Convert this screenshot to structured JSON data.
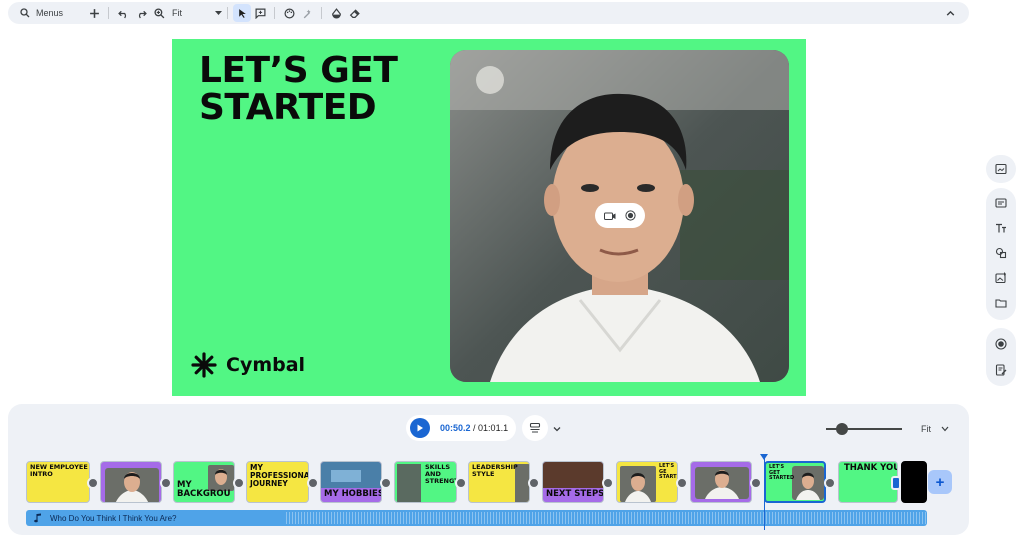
{
  "toolbar": {
    "menus_label": "Menus",
    "zoom_value": "Fit"
  },
  "slide": {
    "title_line1": "LET’S GET",
    "title_line2": "STARTED",
    "brand": "Cymbal",
    "bg_color": "#52f684"
  },
  "player": {
    "current_time": "00:50.2",
    "separator": " / ",
    "total_time": "01:01.1",
    "zoom_fit": "Fit"
  },
  "clips": [
    {
      "label": "NEW EMPLOYEE INTRO",
      "color": "#f5e642"
    },
    {
      "label": "",
      "color": "#a56be8"
    },
    {
      "label": "MY BACKGROU",
      "color": "#52f684"
    },
    {
      "label": "MY PROFESSIONAL JOURNEY",
      "color": "#f5e642"
    },
    {
      "label": "MY HOBBIES",
      "color": "#a56be8"
    },
    {
      "label": "SKILLS AND STRENGTI",
      "color": "#52f684"
    },
    {
      "label": "LEADERSHIP STYLE",
      "color": "#f5e642"
    },
    {
      "label": "NEXT STEPS",
      "color": "#a56be8"
    },
    {
      "label": "LET'S GE STARTED",
      "color": "#f5e642"
    },
    {
      "label": "",
      "color": "#a56be8"
    },
    {
      "label": "LET'S GET STARTED",
      "color": "#52f684"
    },
    {
      "label": "THANK YOU",
      "color": "#52f684"
    }
  ],
  "audio": {
    "track_name": "Who Do You Think I Think You Are?",
    "color": "#4fa3e8"
  },
  "accent": "#1a66d2"
}
